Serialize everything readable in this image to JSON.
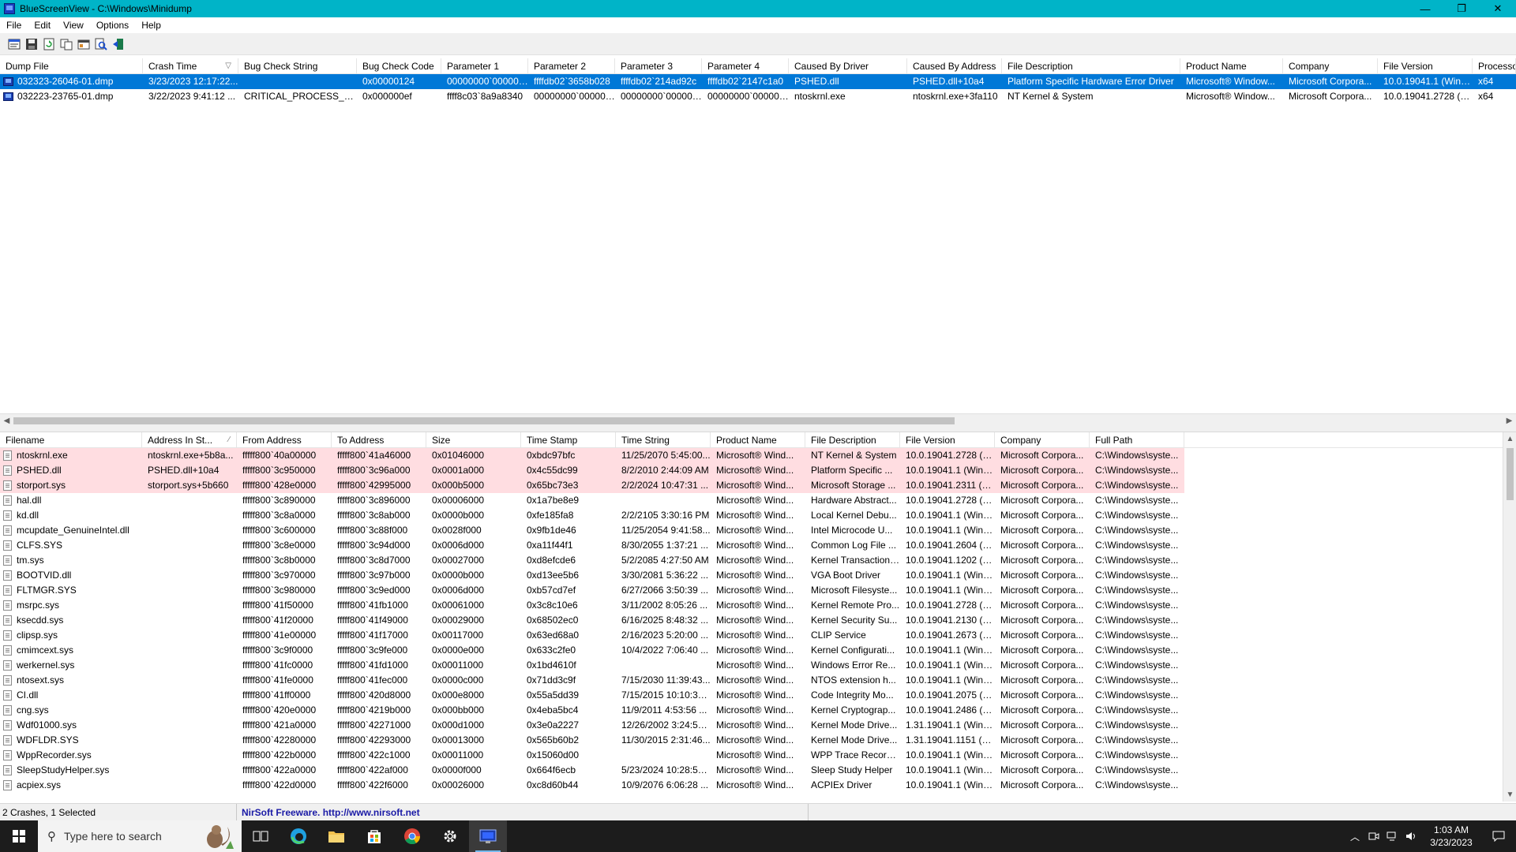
{
  "window": {
    "title": "BlueScreenView  -  C:\\Windows\\Minidump",
    "minimize": "—",
    "maximize": "❐",
    "close": "✕"
  },
  "menu": [
    "File",
    "Edit",
    "View",
    "Options",
    "Help"
  ],
  "toolbar_icons": [
    "properties-icon",
    "save-icon",
    "refresh-icon",
    "copy-icon",
    "html-report-icon",
    "find-icon",
    "exit-icon"
  ],
  "crashes": {
    "columns": [
      "Dump File",
      "Crash Time",
      "Bug Check String",
      "Bug Check Code",
      "Parameter 1",
      "Parameter 2",
      "Parameter 3",
      "Parameter 4",
      "Caused By Driver",
      "Caused By Address",
      "File Description",
      "Product Name",
      "Company",
      "File Version",
      "Processor"
    ],
    "sort_column": "Crash Time",
    "rows": [
      [
        "032323-26046-01.dmp",
        "3/23/2023 12:17:22...",
        "",
        "0x00000124",
        "00000000`000000...",
        "ffffdb02`3658b028",
        "ffffdb02`214ad92c",
        "ffffdb02`2147c1a0",
        "PSHED.dll",
        "PSHED.dll+10a4",
        "Platform Specific Hardware Error Driver",
        "Microsoft® Window...",
        "Microsoft Corpora...",
        "10.0.19041.1 (WinB...",
        "x64"
      ],
      [
        "032223-23765-01.dmp",
        "3/22/2023 9:41:12 ...",
        "CRITICAL_PROCESS_DIED",
        "0x000000ef",
        "ffff8c03`8a9a8340",
        "00000000`000000...",
        "00000000`000000...",
        "00000000`000000...",
        "ntoskrnl.exe",
        "ntoskrnl.exe+3fa110",
        "NT Kernel & System",
        "Microsoft® Window...",
        "Microsoft Corpora...",
        "10.0.19041.2728 (W...",
        "x64"
      ]
    ],
    "selected_row": 0
  },
  "drivers": {
    "columns": [
      "Filename",
      "Address In St...",
      "From Address",
      "To Address",
      "Size",
      "Time Stamp",
      "Time String",
      "Product Name",
      "File Description",
      "File Version",
      "Company",
      "Full Path"
    ],
    "sort_column": "Address In St...",
    "highlight_count": 3,
    "rows": [
      [
        "ntoskrnl.exe",
        "ntoskrnl.exe+5b8a...",
        "fffff800`40a00000",
        "fffff800`41a46000",
        "0x01046000",
        "0xbdc97bfc",
        "11/25/2070 5:45:00...",
        "Microsoft® Wind...",
        "NT Kernel & System",
        "10.0.19041.2728 (W...",
        "Microsoft Corpora...",
        "C:\\Windows\\syste..."
      ],
      [
        "PSHED.dll",
        "PSHED.dll+10a4",
        "fffff800`3c950000",
        "fffff800`3c96a000",
        "0x0001a000",
        "0x4c55dc99",
        "8/2/2010 2:44:09 AM",
        "Microsoft® Wind...",
        "Platform Specific ...",
        "10.0.19041.1 (WinB...",
        "Microsoft Corpora...",
        "C:\\Windows\\syste..."
      ],
      [
        "storport.sys",
        "storport.sys+5b660",
        "fffff800`428e0000",
        "fffff800`42995000",
        "0x000b5000",
        "0x65bc73e3",
        "2/2/2024 10:47:31 ...",
        "Microsoft® Wind...",
        "Microsoft Storage ...",
        "10.0.19041.2311 (W...",
        "Microsoft Corpora...",
        "C:\\Windows\\syste..."
      ],
      [
        "hal.dll",
        "",
        "fffff800`3c890000",
        "fffff800`3c896000",
        "0x00006000",
        "0x1a7be8e9",
        "",
        "Microsoft® Wind...",
        "Hardware Abstract...",
        "10.0.19041.2728 (W...",
        "Microsoft Corpora...",
        "C:\\Windows\\syste..."
      ],
      [
        "kd.dll",
        "",
        "fffff800`3c8a0000",
        "fffff800`3c8ab000",
        "0x0000b000",
        "0xfe185fa8",
        "2/2/2105 3:30:16 PM",
        "Microsoft® Wind...",
        "Local Kernel Debu...",
        "10.0.19041.1 (WinB...",
        "Microsoft Corpora...",
        "C:\\Windows\\syste..."
      ],
      [
        "mcupdate_GenuineIntel.dll",
        "",
        "fffff800`3c600000",
        "fffff800`3c88f000",
        "0x0028f000",
        "0x9fb1de46",
        "11/25/2054 9:41:58...",
        "Microsoft® Wind...",
        "Intel Microcode U...",
        "10.0.19041.1 (WinB...",
        "Microsoft Corpora...",
        "C:\\Windows\\syste..."
      ],
      [
        "CLFS.SYS",
        "",
        "fffff800`3c8e0000",
        "fffff800`3c94d000",
        "0x0006d000",
        "0xa11f44f1",
        "8/30/2055 1:37:21 ...",
        "Microsoft® Wind...",
        "Common Log File ...",
        "10.0.19041.2604 (W...",
        "Microsoft Corpora...",
        "C:\\Windows\\syste..."
      ],
      [
        "tm.sys",
        "",
        "fffff800`3c8b0000",
        "fffff800`3c8d7000",
        "0x00027000",
        "0xd8efcde6",
        "5/2/2085 4:27:50 AM",
        "Microsoft® Wind...",
        "Kernel Transaction ...",
        "10.0.19041.1202 (W...",
        "Microsoft Corpora...",
        "C:\\Windows\\syste..."
      ],
      [
        "BOOTVID.dll",
        "",
        "fffff800`3c970000",
        "fffff800`3c97b000",
        "0x0000b000",
        "0xd13ee5b6",
        "3/30/2081 5:36:22 ...",
        "Microsoft® Wind...",
        "VGA Boot Driver",
        "10.0.19041.1 (WinB...",
        "Microsoft Corpora...",
        "C:\\Windows\\syste..."
      ],
      [
        "FLTMGR.SYS",
        "",
        "fffff800`3c980000",
        "fffff800`3c9ed000",
        "0x0006d000",
        "0xb57cd7ef",
        "6/27/2066 3:50:39 ...",
        "Microsoft® Wind...",
        "Microsoft Filesyste...",
        "10.0.19041.1 (WinB...",
        "Microsoft Corpora...",
        "C:\\Windows\\syste..."
      ],
      [
        "msrpc.sys",
        "",
        "fffff800`41f50000",
        "fffff800`41fb1000",
        "0x00061000",
        "0x3c8c10e6",
        "3/11/2002 8:05:26 ...",
        "Microsoft® Wind...",
        "Kernel Remote Pro...",
        "10.0.19041.2728 (W...",
        "Microsoft Corpora...",
        "C:\\Windows\\syste..."
      ],
      [
        "ksecdd.sys",
        "",
        "fffff800`41f20000",
        "fffff800`41f49000",
        "0x00029000",
        "0x68502ec0",
        "6/16/2025 8:48:32 ...",
        "Microsoft® Wind...",
        "Kernel Security Su...",
        "10.0.19041.2130 (W...",
        "Microsoft Corpora...",
        "C:\\Windows\\syste..."
      ],
      [
        "clipsp.sys",
        "",
        "fffff800`41e00000",
        "fffff800`41f17000",
        "0x00117000",
        "0x63ed68a0",
        "2/16/2023 5:20:00 ...",
        "Microsoft® Wind...",
        "CLIP Service",
        "10.0.19041.2673 (W...",
        "Microsoft Corpora...",
        "C:\\Windows\\syste..."
      ],
      [
        "cmimcext.sys",
        "",
        "fffff800`3c9f0000",
        "fffff800`3c9fe000",
        "0x0000e000",
        "0x633c2fe0",
        "10/4/2022 7:06:40 ...",
        "Microsoft® Wind...",
        "Kernel Configurati...",
        "10.0.19041.1 (WinB...",
        "Microsoft Corpora...",
        "C:\\Windows\\syste..."
      ],
      [
        "werkernel.sys",
        "",
        "fffff800`41fc0000",
        "fffff800`41fd1000",
        "0x00011000",
        "0x1bd4610f",
        "",
        "Microsoft® Wind...",
        "Windows Error Re...",
        "10.0.19041.1 (WinB...",
        "Microsoft Corpora...",
        "C:\\Windows\\syste..."
      ],
      [
        "ntosext.sys",
        "",
        "fffff800`41fe0000",
        "fffff800`41fec000",
        "0x0000c000",
        "0x71dd3c9f",
        "7/15/2030 11:39:43...",
        "Microsoft® Wind...",
        "NTOS extension h...",
        "10.0.19041.1 (WinB...",
        "Microsoft Corpora...",
        "C:\\Windows\\syste..."
      ],
      [
        "CI.dll",
        "",
        "fffff800`41ff0000",
        "fffff800`420d8000",
        "0x000e8000",
        "0x55a5dd39",
        "7/15/2015 10:10:33...",
        "Microsoft® Wind...",
        "Code Integrity Mo...",
        "10.0.19041.2075 (W...",
        "Microsoft Corpora...",
        "C:\\Windows\\syste..."
      ],
      [
        "cng.sys",
        "",
        "fffff800`420e0000",
        "fffff800`4219b000",
        "0x000bb000",
        "0x4eba5bc4",
        "11/9/2011 4:53:56 ...",
        "Microsoft® Wind...",
        "Kernel Cryptograp...",
        "10.0.19041.2486 (W...",
        "Microsoft Corpora...",
        "C:\\Windows\\syste..."
      ],
      [
        "Wdf01000.sys",
        "",
        "fffff800`421a0000",
        "fffff800`42271000",
        "0x000d1000",
        "0x3e0a2227",
        "12/26/2002 3:24:55...",
        "Microsoft® Wind...",
        "Kernel Mode Drive...",
        "1.31.19041.1 (WinB...",
        "Microsoft Corpora...",
        "C:\\Windows\\syste..."
      ],
      [
        "WDFLDR.SYS",
        "",
        "fffff800`42280000",
        "fffff800`42293000",
        "0x00013000",
        "0x565b60b2",
        "11/30/2015 2:31:46...",
        "Microsoft® Wind...",
        "Kernel Mode Drive...",
        "1.31.19041.1151 (W...",
        "Microsoft Corpora...",
        "C:\\Windows\\syste..."
      ],
      [
        "WppRecorder.sys",
        "",
        "fffff800`422b0000",
        "fffff800`422c1000",
        "0x00011000",
        "0x15060d00",
        "",
        "Microsoft® Wind...",
        "WPP Trace Recorder",
        "10.0.19041.1 (WinB...",
        "Microsoft Corpora...",
        "C:\\Windows\\syste..."
      ],
      [
        "SleepStudyHelper.sys",
        "",
        "fffff800`422a0000",
        "fffff800`422af000",
        "0x0000f000",
        "0x664f6ecb",
        "5/23/2024 10:28:59...",
        "Microsoft® Wind...",
        "Sleep Study Helper",
        "10.0.19041.1 (WinB...",
        "Microsoft Corpora...",
        "C:\\Windows\\syste..."
      ],
      [
        "acpiex.sys",
        "",
        "fffff800`422d0000",
        "fffff800`422f6000",
        "0x00026000",
        "0xc8d60b44",
        "10/9/2076 6:06:28 ...",
        "Microsoft® Wind...",
        "ACPIEx Driver",
        "10.0.19041.1 (WinB...",
        "Microsoft Corpora...",
        "C:\\Windows\\syste..."
      ]
    ]
  },
  "status": {
    "count": "2 Crashes, 1 Selected",
    "freeware": "NirSoft Freeware.  http://www.nirsoft.net"
  },
  "taskbar": {
    "search_placeholder": "Type here to search",
    "apps": [
      "task-view-icon",
      "edge-icon",
      "file-explorer-icon",
      "store-icon",
      "chrome-icon",
      "settings-icon",
      "bluescreenview-icon"
    ],
    "time": "1:03 AM",
    "date": "3/23/2023"
  }
}
